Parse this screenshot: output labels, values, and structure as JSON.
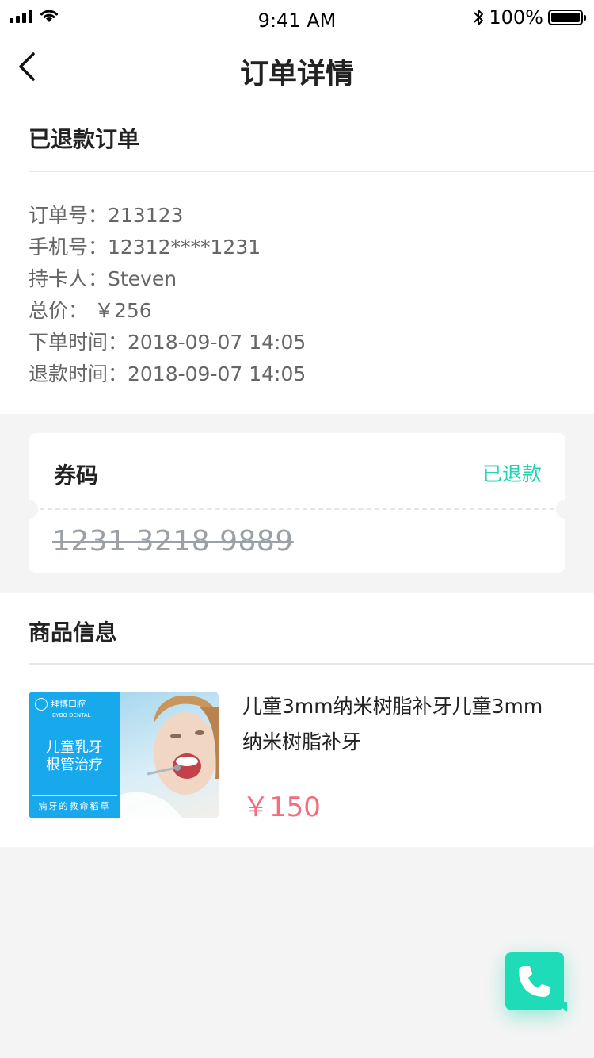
{
  "status_bar": {
    "time": "9:41 AM",
    "battery": "100%",
    "icons": [
      "signal-icon",
      "wifi-icon",
      "bluetooth-icon",
      "battery-icon"
    ]
  },
  "nav": {
    "back_icon": "chevron-left-icon",
    "title": "订单详情"
  },
  "order": {
    "status_title": "已退款订单",
    "fields": [
      "订单号：213123",
      "手机号：12312****1231",
      "持卡人：Steven",
      "总价： ￥256",
      "下单时间：2018-09-07 14:05",
      "退款时间：2018-09-07 14:05"
    ]
  },
  "coupon": {
    "label": "券码",
    "status": "已退款",
    "status_color": "#22d3b4",
    "code": "1231 3218 9889"
  },
  "goods": {
    "section_title": "商品信息",
    "item": {
      "name": "儿童3mm纳米树脂补牙儿童3mm纳米树脂补牙",
      "price": "￥150",
      "price_color": "#f26d7d",
      "thumb": {
        "brand": "拜博口腔",
        "brand_en": "BYBO DENTAL",
        "main_line1": "儿童乳牙",
        "main_line2": "根管治疗",
        "tag": "病牙的救命稻草"
      }
    }
  },
  "fab": {
    "icon": "phone-icon",
    "color": "#1fdcb8"
  }
}
